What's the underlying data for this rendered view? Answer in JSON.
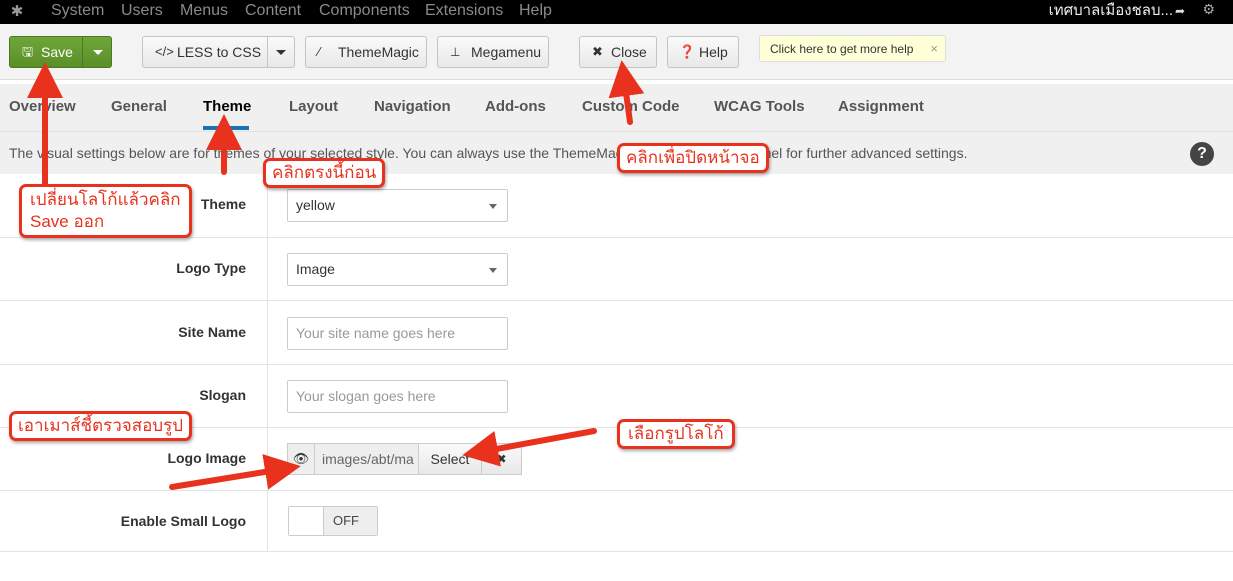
{
  "menubar": {
    "logo_icon": "joomla-icon",
    "items": [
      "System",
      "Users",
      "Menus",
      "Content",
      "Components",
      "Extensions",
      "Help"
    ],
    "site_name": "เทศบาลเมืองชลบ...",
    "site_icon": "external-link-icon",
    "settings_icon": "gear-icon"
  },
  "toolbar": {
    "save": "Save",
    "less_to_css": "LESS to CSS",
    "thememagic": "ThemeMagic",
    "megamenu": "Megamenu",
    "close": "Close",
    "help": "Help",
    "help_popover": "Click here to get more help",
    "help_popover_close": "×"
  },
  "tabs": [
    {
      "label": "Overview"
    },
    {
      "label": "General"
    },
    {
      "label": "Theme"
    },
    {
      "label": "Layout"
    },
    {
      "label": "Navigation"
    },
    {
      "label": "Add-ons"
    },
    {
      "label": "Custom Code"
    },
    {
      "label": "WCAG Tools"
    },
    {
      "label": "Assignment"
    }
  ],
  "active_tab": "Theme",
  "intro_text": "The visual settings below are for themes of your selected style. You can always use the ThemeMagic from the top-right panel for further advanced settings.",
  "help_mark": "?",
  "form": {
    "theme": {
      "label": "Theme",
      "value": "yellow"
    },
    "logo_type": {
      "label": "Logo Type",
      "value": "Image"
    },
    "site_name": {
      "label": "Site Name",
      "placeholder": "Your site name goes here"
    },
    "slogan": {
      "label": "Slogan",
      "placeholder": "Your slogan goes here"
    },
    "logo_image": {
      "label": "Logo Image",
      "path": "images/abt/ma",
      "select": "Select",
      "clear": "✖",
      "preview_icon": "eye-icon"
    },
    "small_logo": {
      "label": "Enable Small Logo",
      "state": "OFF"
    }
  },
  "annotations": {
    "click_first": "คลิกตรงนี้ก่อน",
    "click_close": "คลิกเพื่อปิดหน้าจอ",
    "change_logo_line1": "เปลี่ยนโลโก้แล้วคลิก",
    "change_logo_line2": "Save ออก",
    "hover_check": "เอาเมาส์ชี้ตรวจสอบรูป",
    "choose_logo": "เลือกรูปโลโก้",
    "color": "#e8321d"
  }
}
